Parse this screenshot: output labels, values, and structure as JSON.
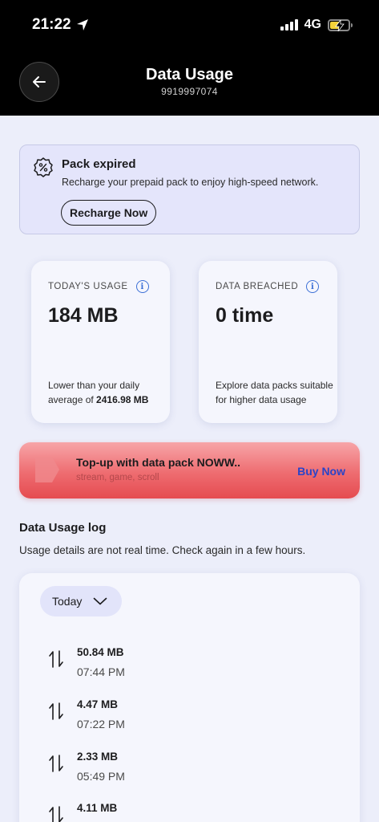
{
  "status_bar": {
    "time": "21:22",
    "network": "4G"
  },
  "header": {
    "title": "Data Usage",
    "phone_number": "9919997074"
  },
  "pack_alert": {
    "title": "Pack expired",
    "description": "Recharge your prepaid pack to enjoy high-speed network.",
    "button_label": "Recharge Now"
  },
  "todays_usage": {
    "label": "TODAY'S USAGE",
    "value": "184 MB",
    "note_prefix": "Lower than your daily average of ",
    "note_value": "2416.98 MB"
  },
  "data_breached": {
    "label": "DATA BREACHED",
    "value": "0 time",
    "note": "Explore data packs suitable for higher data usage"
  },
  "topup_banner": {
    "title": "Top-up with data pack NOWW..",
    "subtitle": "stream, game, scroll",
    "cta": "Buy Now"
  },
  "usage_log": {
    "title": "Data Usage log",
    "description": "Usage details are not real time. Check again in a few hours.",
    "filter": "Today",
    "entries": [
      {
        "amount": "50.84 MB",
        "time": "07:44 PM"
      },
      {
        "amount": "4.47 MB",
        "time": "07:22 PM"
      },
      {
        "amount": "2.33 MB",
        "time": "05:49 PM"
      },
      {
        "amount": "4.11 MB",
        "time": ""
      }
    ]
  },
  "colors": {
    "accent": "#2a44c8",
    "info": "#3b6fd6",
    "banner_red": "#e54b50",
    "background": "#eceefa"
  },
  "battery_level": 0.6
}
